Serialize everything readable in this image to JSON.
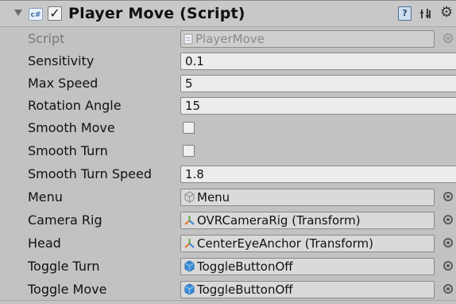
{
  "component": {
    "title": "Player Move (Script)",
    "enabled": true,
    "script_icon_text": "c#",
    "help_icon_text": "?",
    "icons": [
      "foldout-arrow-icon",
      "script-icon",
      "help-icon",
      "preset-icon",
      "gear-icon"
    ]
  },
  "properties": [
    {
      "label": "Script",
      "type": "object",
      "value": "PlayerMove",
      "icon": "script-file-icon",
      "disabled": true
    },
    {
      "label": "Sensitivity",
      "type": "float",
      "value": "0.1"
    },
    {
      "label": "Max Speed",
      "type": "float",
      "value": "5"
    },
    {
      "label": "Rotation Angle",
      "type": "float",
      "value": "15"
    },
    {
      "label": "Smooth Move",
      "type": "bool",
      "value": false
    },
    {
      "label": "Smooth Turn",
      "type": "bool",
      "value": false
    },
    {
      "label": "Smooth Turn Speed",
      "type": "float",
      "value": "1.8"
    },
    {
      "label": "Menu",
      "type": "object",
      "value": "Menu",
      "icon": "gameobject-icon-gray"
    },
    {
      "label": "Camera Rig",
      "type": "object",
      "value": "OVRCameraRig (Transform)",
      "icon": "transform-icon"
    },
    {
      "label": "Head",
      "type": "object",
      "value": "CenterEyeAnchor (Transform)",
      "icon": "transform-icon"
    },
    {
      "label": "Toggle Turn",
      "type": "object",
      "value": "ToggleButtonOff",
      "icon": "prefab-icon"
    },
    {
      "label": "Toggle Move",
      "type": "object",
      "value": "ToggleButtonOff",
      "icon": "prefab-icon"
    }
  ],
  "colors": {
    "panel_bg": "#c2c2c2",
    "field_bg": "#ececec",
    "prefab_blue": "#3a8fd8",
    "transform_orange": "#e2732b"
  }
}
